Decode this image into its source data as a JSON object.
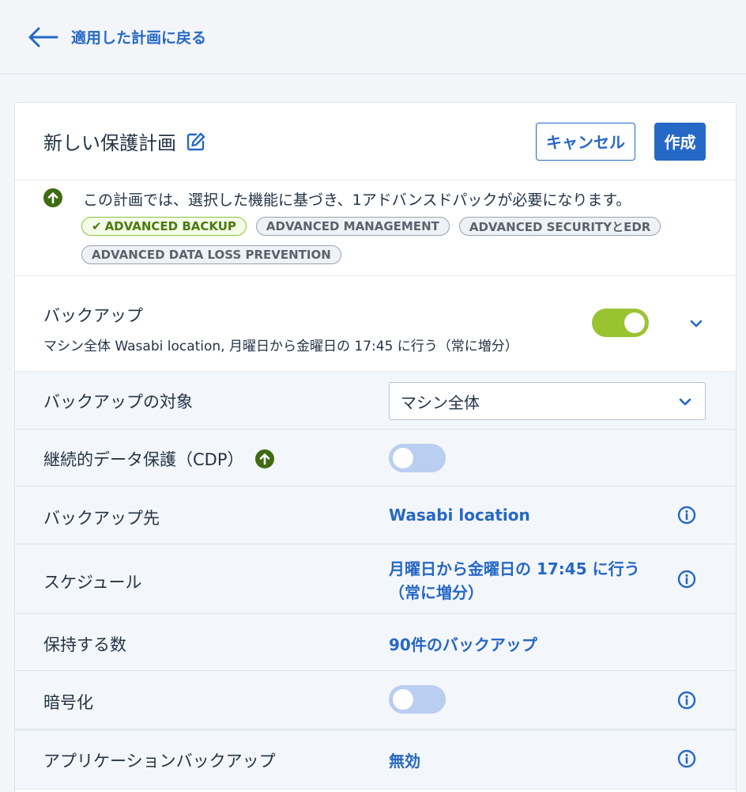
{
  "nav": {
    "back_label": "適用した計画に戻る"
  },
  "plan": {
    "title": "新しい保護計画",
    "cancel_label": "キャンセル",
    "create_label": "作成"
  },
  "notice": {
    "message": "この計画では、選択した機能に基づき、1アドバンスドパックが必要になります。",
    "tags": [
      {
        "label": "ADVANCED BACKUP",
        "active": true
      },
      {
        "label": "ADVANCED MANAGEMENT",
        "active": false
      },
      {
        "label": "ADVANCED SECURITYとEDR",
        "active": false
      },
      {
        "label": "ADVANCED DATA LOSS PREVENTION",
        "active": false
      }
    ]
  },
  "backup": {
    "label": "バックアップ",
    "summary": "マシン全体 Wasabi location, 月曜日から金曜日の 17:45 に行う（常に増分）",
    "enabled": true
  },
  "settings": {
    "target": {
      "label": "バックアップの対象",
      "value": "マシン全体"
    },
    "cdp": {
      "label": "継続的データ保護（CDP）",
      "enabled": false
    },
    "destination": {
      "label": "バックアップ先",
      "value": "Wasabi location"
    },
    "schedule": {
      "label": "スケジュール",
      "value_line1": "月曜日から金曜日の 17:45 に行う",
      "value_line2": "（常に増分）"
    },
    "retention": {
      "label": "保持する数",
      "value": "90件のバックアップ"
    },
    "encryption": {
      "label": "暗号化",
      "enabled": false
    },
    "app_backup": {
      "label": "アプリケーションバックアップ",
      "value": "無効"
    }
  },
  "colors": {
    "accent": "#2668c5",
    "toggle_on": "#9ac332",
    "toggle_off": "#b9cef0",
    "upgrade_icon": "#3f6b12",
    "active_tag": "#8cc13f"
  }
}
